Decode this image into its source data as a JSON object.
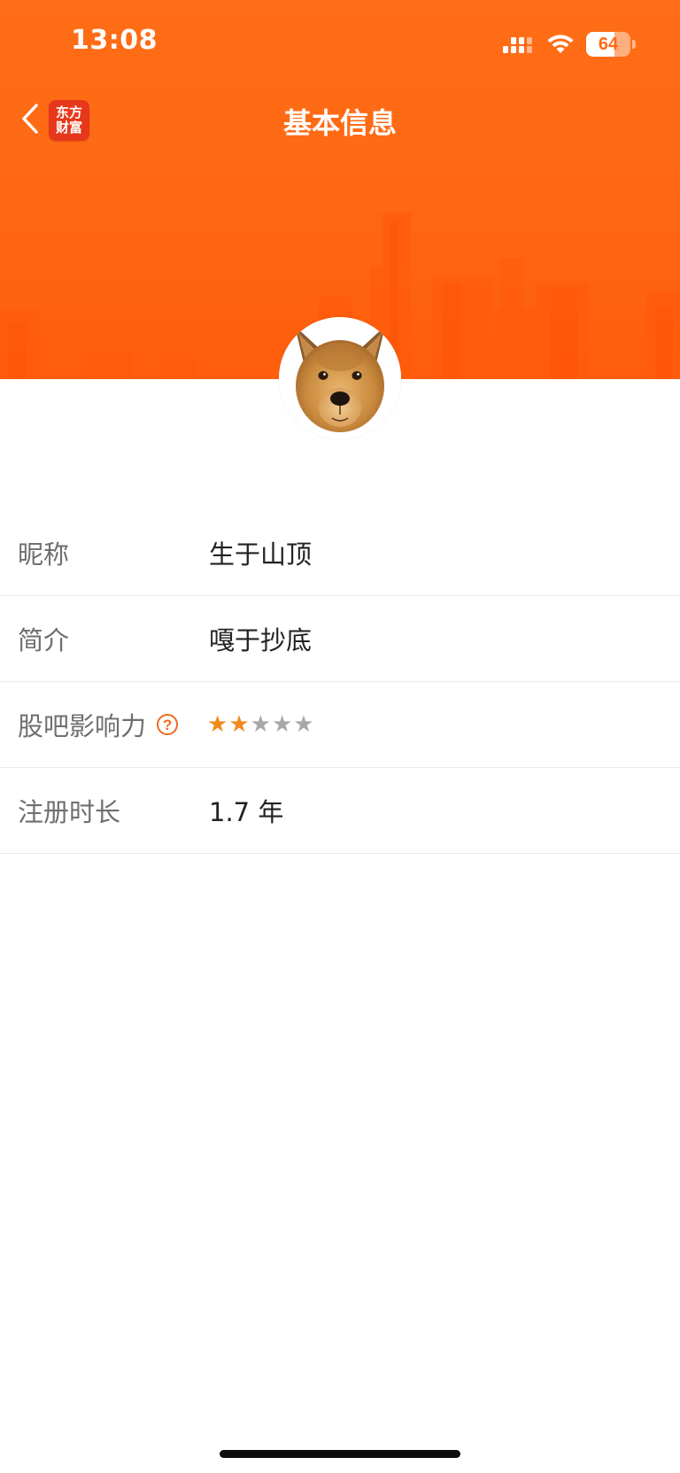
{
  "status_bar": {
    "time": "13:08",
    "battery": "64",
    "battery_level": 0.64,
    "signal_icon": "cellular-signal-icon",
    "wifi_icon": "wifi-icon"
  },
  "nav": {
    "back_icon": "chevron-left-icon",
    "logo_line1": "东方",
    "logo_line2": "财富",
    "title": "基本信息"
  },
  "theme": {
    "banner_color": "#ff6a14",
    "accent_orange": "#ee6a1e",
    "star_active": "#f28a1f",
    "star_inactive": "#a8a8a8"
  },
  "profile": {
    "avatar": "dog-avatar"
  },
  "info": {
    "nickname_label": "昵称",
    "nickname_value": "生于山顶",
    "bio_label": "简介",
    "bio_value": "嘎于抄底",
    "influence_label": "股吧影响力",
    "influence_help": "?",
    "influence_stars_filled": 2,
    "influence_stars_total": 5,
    "influence_star_glyph": "★",
    "registration_label": "注册时长",
    "registration_value": "1.7 年"
  }
}
